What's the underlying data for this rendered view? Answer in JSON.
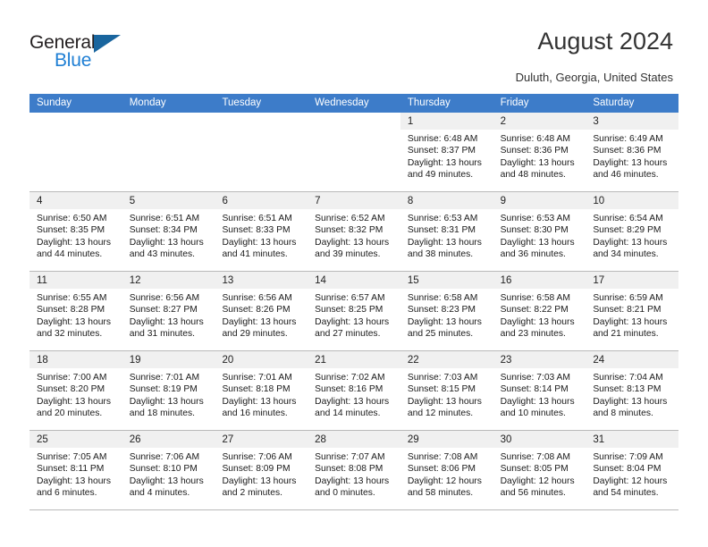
{
  "brand": {
    "name_part1": "General",
    "name_part2": "Blue",
    "accent_color": "#1f7fd4",
    "triangle_color": "#19659e"
  },
  "header": {
    "title": "August 2024",
    "location": "Duluth, Georgia, United States"
  },
  "theme": {
    "header_row_color": "#3d7cc9",
    "day_band_color": "#f0f0f0",
    "grid_line_color": "#b9b9b9"
  },
  "weekdays": [
    "Sunday",
    "Monday",
    "Tuesday",
    "Wednesday",
    "Thursday",
    "Friday",
    "Saturday"
  ],
  "weeks": [
    [
      {
        "day": "",
        "blank": true,
        "lines": []
      },
      {
        "day": "",
        "blank": true,
        "lines": []
      },
      {
        "day": "",
        "blank": true,
        "lines": []
      },
      {
        "day": "",
        "blank": true,
        "lines": []
      },
      {
        "day": "1",
        "lines": [
          "Sunrise: 6:48 AM",
          "Sunset: 8:37 PM",
          "Daylight: 13 hours",
          "and 49 minutes."
        ]
      },
      {
        "day": "2",
        "lines": [
          "Sunrise: 6:48 AM",
          "Sunset: 8:36 PM",
          "Daylight: 13 hours",
          "and 48 minutes."
        ]
      },
      {
        "day": "3",
        "lines": [
          "Sunrise: 6:49 AM",
          "Sunset: 8:36 PM",
          "Daylight: 13 hours",
          "and 46 minutes."
        ]
      }
    ],
    [
      {
        "day": "4",
        "lines": [
          "Sunrise: 6:50 AM",
          "Sunset: 8:35 PM",
          "Daylight: 13 hours",
          "and 44 minutes."
        ]
      },
      {
        "day": "5",
        "lines": [
          "Sunrise: 6:51 AM",
          "Sunset: 8:34 PM",
          "Daylight: 13 hours",
          "and 43 minutes."
        ]
      },
      {
        "day": "6",
        "lines": [
          "Sunrise: 6:51 AM",
          "Sunset: 8:33 PM",
          "Daylight: 13 hours",
          "and 41 minutes."
        ]
      },
      {
        "day": "7",
        "lines": [
          "Sunrise: 6:52 AM",
          "Sunset: 8:32 PM",
          "Daylight: 13 hours",
          "and 39 minutes."
        ]
      },
      {
        "day": "8",
        "lines": [
          "Sunrise: 6:53 AM",
          "Sunset: 8:31 PM",
          "Daylight: 13 hours",
          "and 38 minutes."
        ]
      },
      {
        "day": "9",
        "lines": [
          "Sunrise: 6:53 AM",
          "Sunset: 8:30 PM",
          "Daylight: 13 hours",
          "and 36 minutes."
        ]
      },
      {
        "day": "10",
        "lines": [
          "Sunrise: 6:54 AM",
          "Sunset: 8:29 PM",
          "Daylight: 13 hours",
          "and 34 minutes."
        ]
      }
    ],
    [
      {
        "day": "11",
        "lines": [
          "Sunrise: 6:55 AM",
          "Sunset: 8:28 PM",
          "Daylight: 13 hours",
          "and 32 minutes."
        ]
      },
      {
        "day": "12",
        "lines": [
          "Sunrise: 6:56 AM",
          "Sunset: 8:27 PM",
          "Daylight: 13 hours",
          "and 31 minutes."
        ]
      },
      {
        "day": "13",
        "lines": [
          "Sunrise: 6:56 AM",
          "Sunset: 8:26 PM",
          "Daylight: 13 hours",
          "and 29 minutes."
        ]
      },
      {
        "day": "14",
        "lines": [
          "Sunrise: 6:57 AM",
          "Sunset: 8:25 PM",
          "Daylight: 13 hours",
          "and 27 minutes."
        ]
      },
      {
        "day": "15",
        "lines": [
          "Sunrise: 6:58 AM",
          "Sunset: 8:23 PM",
          "Daylight: 13 hours",
          "and 25 minutes."
        ]
      },
      {
        "day": "16",
        "lines": [
          "Sunrise: 6:58 AM",
          "Sunset: 8:22 PM",
          "Daylight: 13 hours",
          "and 23 minutes."
        ]
      },
      {
        "day": "17",
        "lines": [
          "Sunrise: 6:59 AM",
          "Sunset: 8:21 PM",
          "Daylight: 13 hours",
          "and 21 minutes."
        ]
      }
    ],
    [
      {
        "day": "18",
        "lines": [
          "Sunrise: 7:00 AM",
          "Sunset: 8:20 PM",
          "Daylight: 13 hours",
          "and 20 minutes."
        ]
      },
      {
        "day": "19",
        "lines": [
          "Sunrise: 7:01 AM",
          "Sunset: 8:19 PM",
          "Daylight: 13 hours",
          "and 18 minutes."
        ]
      },
      {
        "day": "20",
        "lines": [
          "Sunrise: 7:01 AM",
          "Sunset: 8:18 PM",
          "Daylight: 13 hours",
          "and 16 minutes."
        ]
      },
      {
        "day": "21",
        "lines": [
          "Sunrise: 7:02 AM",
          "Sunset: 8:16 PM",
          "Daylight: 13 hours",
          "and 14 minutes."
        ]
      },
      {
        "day": "22",
        "lines": [
          "Sunrise: 7:03 AM",
          "Sunset: 8:15 PM",
          "Daylight: 13 hours",
          "and 12 minutes."
        ]
      },
      {
        "day": "23",
        "lines": [
          "Sunrise: 7:03 AM",
          "Sunset: 8:14 PM",
          "Daylight: 13 hours",
          "and 10 minutes."
        ]
      },
      {
        "day": "24",
        "lines": [
          "Sunrise: 7:04 AM",
          "Sunset: 8:13 PM",
          "Daylight: 13 hours",
          "and 8 minutes."
        ]
      }
    ],
    [
      {
        "day": "25",
        "lines": [
          "Sunrise: 7:05 AM",
          "Sunset: 8:11 PM",
          "Daylight: 13 hours",
          "and 6 minutes."
        ]
      },
      {
        "day": "26",
        "lines": [
          "Sunrise: 7:06 AM",
          "Sunset: 8:10 PM",
          "Daylight: 13 hours",
          "and 4 minutes."
        ]
      },
      {
        "day": "27",
        "lines": [
          "Sunrise: 7:06 AM",
          "Sunset: 8:09 PM",
          "Daylight: 13 hours",
          "and 2 minutes."
        ]
      },
      {
        "day": "28",
        "lines": [
          "Sunrise: 7:07 AM",
          "Sunset: 8:08 PM",
          "Daylight: 13 hours",
          "and 0 minutes."
        ]
      },
      {
        "day": "29",
        "lines": [
          "Sunrise: 7:08 AM",
          "Sunset: 8:06 PM",
          "Daylight: 12 hours",
          "and 58 minutes."
        ]
      },
      {
        "day": "30",
        "lines": [
          "Sunrise: 7:08 AM",
          "Sunset: 8:05 PM",
          "Daylight: 12 hours",
          "and 56 minutes."
        ]
      },
      {
        "day": "31",
        "lines": [
          "Sunrise: 7:09 AM",
          "Sunset: 8:04 PM",
          "Daylight: 12 hours",
          "and 54 minutes."
        ]
      }
    ]
  ]
}
